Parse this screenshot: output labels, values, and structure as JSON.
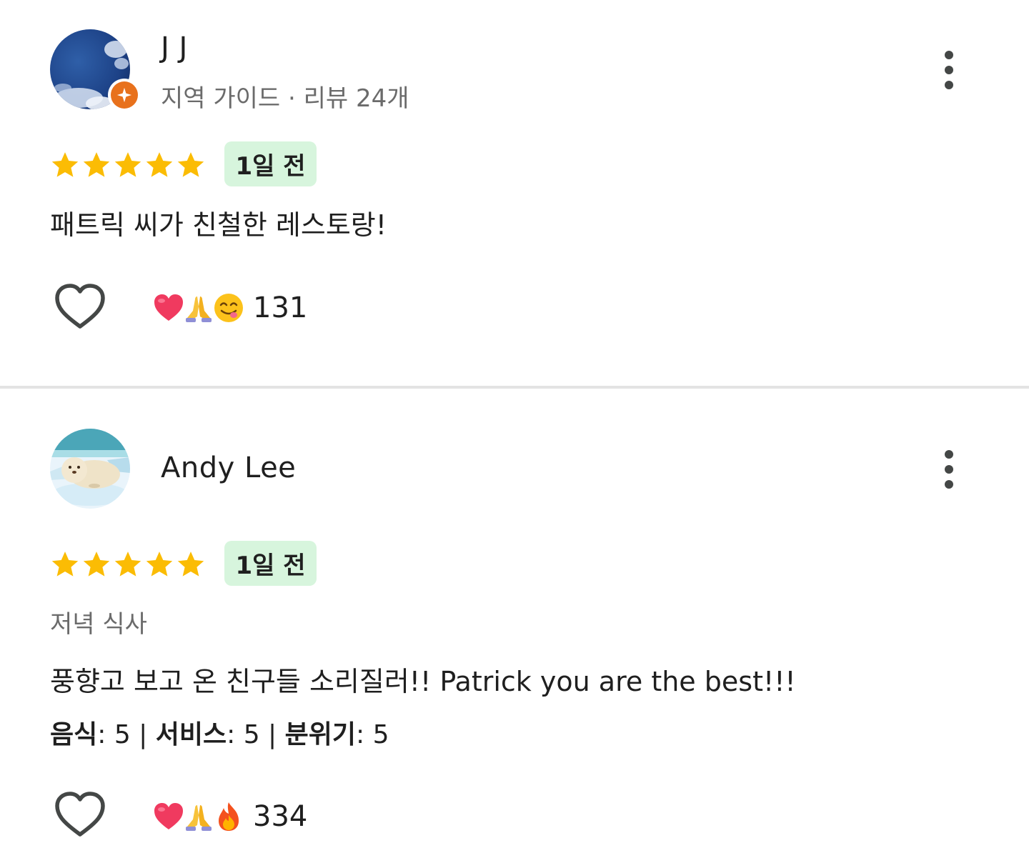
{
  "reviews": [
    {
      "author": "J J",
      "meta": "지역 가이드 · 리뷰 24개",
      "rating": 5,
      "time": "1일 전",
      "text": "패트릭 씨가 친철한 레스토랑!",
      "reaction_icons": [
        "heart-emoji",
        "folded-hands-emoji",
        "yum-face-emoji"
      ],
      "reaction_count": "131"
    },
    {
      "author": "Andy Lee",
      "rating": 5,
      "time": "1일 전",
      "meal_type": "저녁 식사",
      "text": "풍향고 보고 온 친구들 소리질러!! Patrick you are the best!!!",
      "sub_ratings": [
        {
          "label": "음식",
          "value": ": 5 | "
        },
        {
          "label": "서비스",
          "value": ": 5 | "
        },
        {
          "label": "분위기",
          "value": ": 5"
        }
      ],
      "reaction_icons": [
        "heart-emoji",
        "folded-hands-emoji",
        "fire-emoji"
      ],
      "reaction_count": "334"
    }
  ],
  "colors": {
    "star": "#fbbc04",
    "time_chip_bg": "#d7f5dd",
    "guide_badge": "#e8711c",
    "divider": "#e3e3e3"
  }
}
